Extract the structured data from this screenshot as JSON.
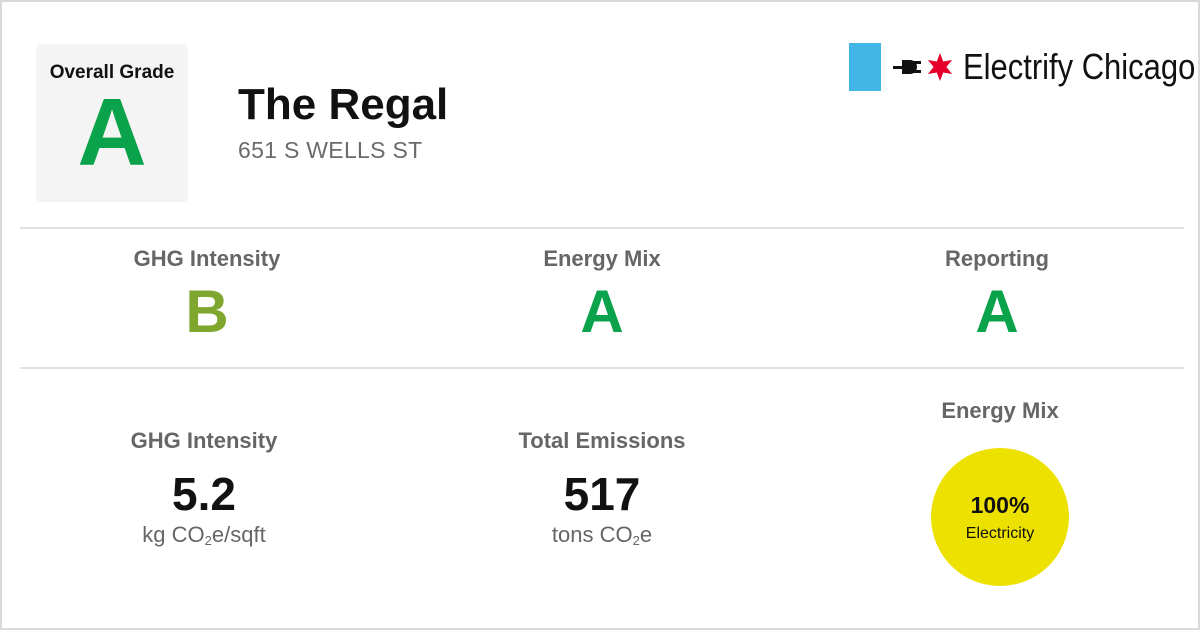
{
  "colors": {
    "grade_a": "#0aa24a",
    "grade_b": "#7fa62e",
    "logo_bar": "#41b6e6",
    "logo_star": "#e4002b",
    "electricity_circle": "#ede100"
  },
  "overall": {
    "label": "Overall Grade",
    "grade": "A"
  },
  "building": {
    "name": "The Regal",
    "address": "651 S WELLS ST"
  },
  "logo": {
    "icons": [
      "plug-icon",
      "star-icon"
    ],
    "text": "Electrify Chicago"
  },
  "grades": [
    {
      "label": "GHG Intensity",
      "grade": "B"
    },
    {
      "label": "Energy Mix",
      "grade": "A"
    },
    {
      "label": "Reporting",
      "grade": "A"
    }
  ],
  "metrics": {
    "ghg_intensity": {
      "label": "GHG Intensity",
      "value": "5.2",
      "unit_pre": "kg CO",
      "unit_sub": "2",
      "unit_post": "e/sqft"
    },
    "total_emissions": {
      "label": "Total Emissions",
      "value": "517",
      "unit_pre": "tons CO",
      "unit_sub": "2",
      "unit_post": "e"
    },
    "energy_mix": {
      "label": "Energy Mix",
      "percent": "100%",
      "source": "Electricity"
    }
  }
}
